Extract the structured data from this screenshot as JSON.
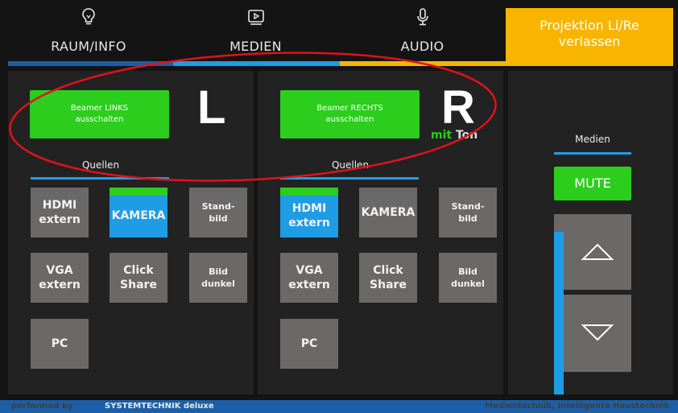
{
  "nav": {
    "tabs": [
      {
        "label": "RAUM/INFO",
        "icon": "lightbulb-icon"
      },
      {
        "label": "MEDIEN",
        "icon": "play-screen-icon"
      },
      {
        "label": "AUDIO",
        "icon": "microphone-icon"
      }
    ],
    "exit_label": "Projektion Li/Re\nverlassen"
  },
  "left": {
    "power_button": "Beamer LINKS\nausschalten",
    "letter": "L",
    "sources_label": "Quellen",
    "sources": [
      {
        "label": "HDMI\nextern",
        "active": false
      },
      {
        "label": "KAMERA",
        "active": true
      },
      {
        "label": "Stand-\nbild",
        "active": false
      },
      {
        "label": "VGA\nextern",
        "active": false
      },
      {
        "label": "Click\nShare",
        "active": false
      },
      {
        "label": "Bild\ndunkel",
        "active": false
      },
      {
        "label": "PC",
        "active": false
      }
    ]
  },
  "right": {
    "power_button": "Beamer RECHTS\nausschalten",
    "letter": "R",
    "audio_note_mit": "mit",
    "audio_note_ton": "Ton",
    "sources_label": "Quellen",
    "sources": [
      {
        "label": "HDMI\nextern",
        "active": true
      },
      {
        "label": "KAMERA",
        "active": false
      },
      {
        "label": "Stand-\nbild",
        "active": false
      },
      {
        "label": "VGA\nextern",
        "active": false
      },
      {
        "label": "Click\nShare",
        "active": false
      },
      {
        "label": "Bild\ndunkel",
        "active": false
      },
      {
        "label": "PC",
        "active": false
      }
    ]
  },
  "volume": {
    "label": "Medien",
    "mute_label": "MUTE",
    "level": 0.9
  },
  "footer": {
    "performed_by": "performed by",
    "brand": "SYSTEMTECHNIK deluxe",
    "tagline": "Medientechnik, Intelligente Haustechnik"
  },
  "colors": {
    "green": "#2ccd1d",
    "blue": "#1e9de4",
    "yellow": "#f7b500",
    "button_gray": "#6b6868"
  }
}
